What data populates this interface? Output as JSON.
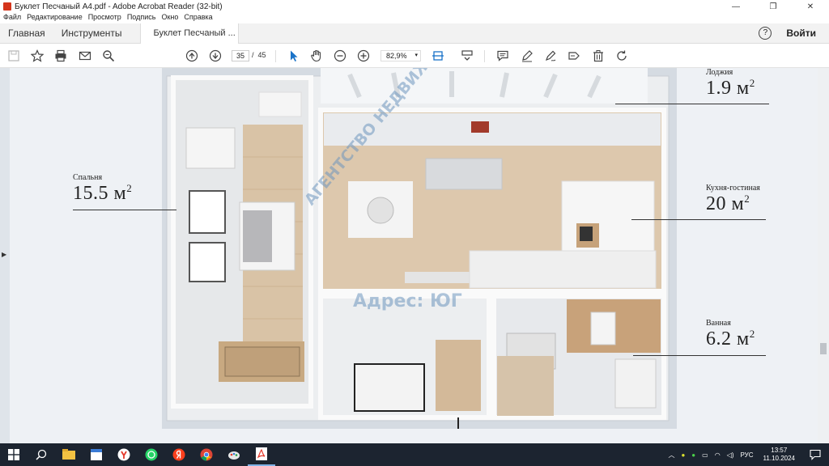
{
  "window": {
    "title": "Буклет Песчаный А4.pdf - Adobe Acrobat Reader (32-bit)",
    "minimize": "—",
    "restore": "❐",
    "close": "✕"
  },
  "menu": [
    "Файл",
    "Редактирование",
    "Просмотр",
    "Подпись",
    "Окно",
    "Справка"
  ],
  "tabs": {
    "home": "Главная",
    "tools": "Инструменты",
    "document": "Буклет Песчаный ...",
    "help": "?",
    "signin": "Войти"
  },
  "toolbar": {
    "current_page": "35",
    "page_separator": "/",
    "total_pages": "45",
    "zoom": "82,9%",
    "zoom_arrow": "▾"
  },
  "plan": {
    "rooms": [
      {
        "name": "Лоджия",
        "area": "1.9 м",
        "sup": "2"
      },
      {
        "name": "Спальня",
        "area": "15.5 м",
        "sup": "2"
      },
      {
        "name": "Кухня-гостиная",
        "area": "20 м",
        "sup": "2"
      },
      {
        "name": "Ванная",
        "area": "6.2 м",
        "sup": "2"
      }
    ],
    "watermark_top": "АГЕНТСТВО НЕДВИЖИМОСТИ",
    "watermark_bottom": "Адрес: ЮГ"
  },
  "taskbar": {
    "language": "РУС",
    "time": "13:57",
    "date": "11.10.2024"
  }
}
